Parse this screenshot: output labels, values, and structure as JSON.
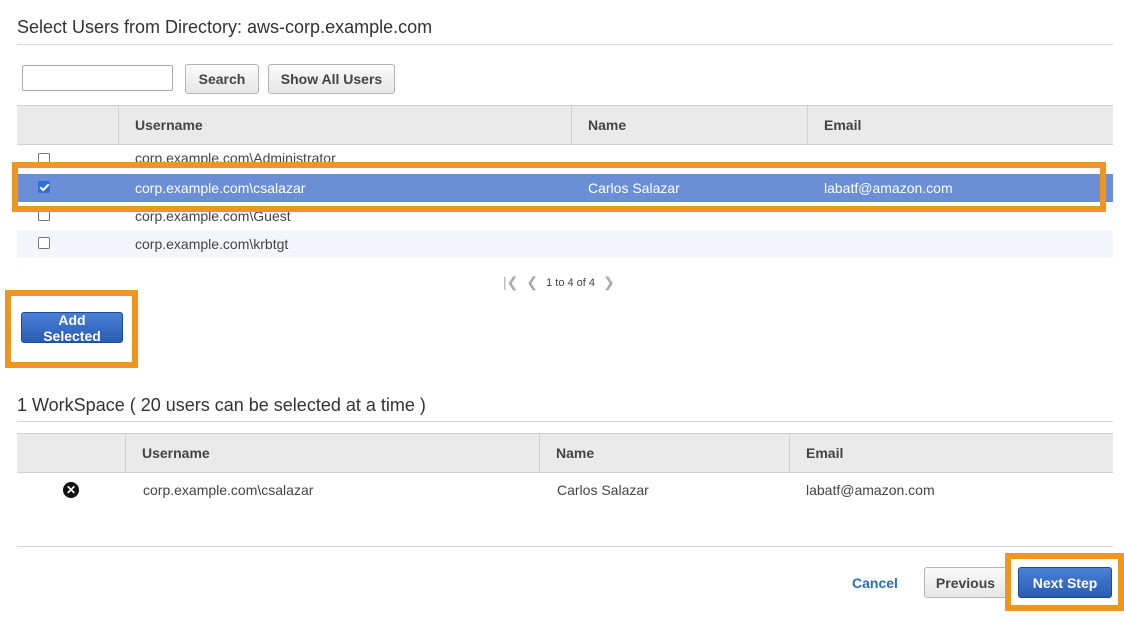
{
  "select_section": {
    "title": "Select Users from Directory: aws-corp.example.com",
    "search": {
      "value": "",
      "placeholder": ""
    },
    "search_button": "Search",
    "show_all_button": "Show All Users",
    "columns": [
      "Username",
      "Name",
      "Email"
    ],
    "rows": [
      {
        "checked": false,
        "username": "corp.example.com\\Administrator",
        "name": "",
        "email": ""
      },
      {
        "checked": true,
        "username": "corp.example.com\\csalazar",
        "name": "Carlos Salazar",
        "email": "labatf@amazon.com"
      },
      {
        "checked": false,
        "username": "corp.example.com\\Guest",
        "name": "",
        "email": ""
      },
      {
        "checked": false,
        "username": "corp.example.com\\krbtgt",
        "name": "",
        "email": ""
      }
    ],
    "pagination": {
      "text": "1 to 4 of 4"
    },
    "add_selected_button": "Add Selected"
  },
  "workspace_section": {
    "title": "1 WorkSpace ( 20 users can be selected at a time )",
    "columns": [
      "Username",
      "Name",
      "Email"
    ],
    "rows": [
      {
        "username": "corp.example.com\\csalazar",
        "name": "Carlos Salazar",
        "email": "labatf@amazon.com"
      }
    ]
  },
  "footer": {
    "cancel": "Cancel",
    "previous": "Previous",
    "next": "Next Step"
  },
  "colors": {
    "highlight": "#f0961e",
    "selected_row": "#6b8fd6",
    "primary_button": "#2a5cb4",
    "link": "#2a6ebb"
  }
}
